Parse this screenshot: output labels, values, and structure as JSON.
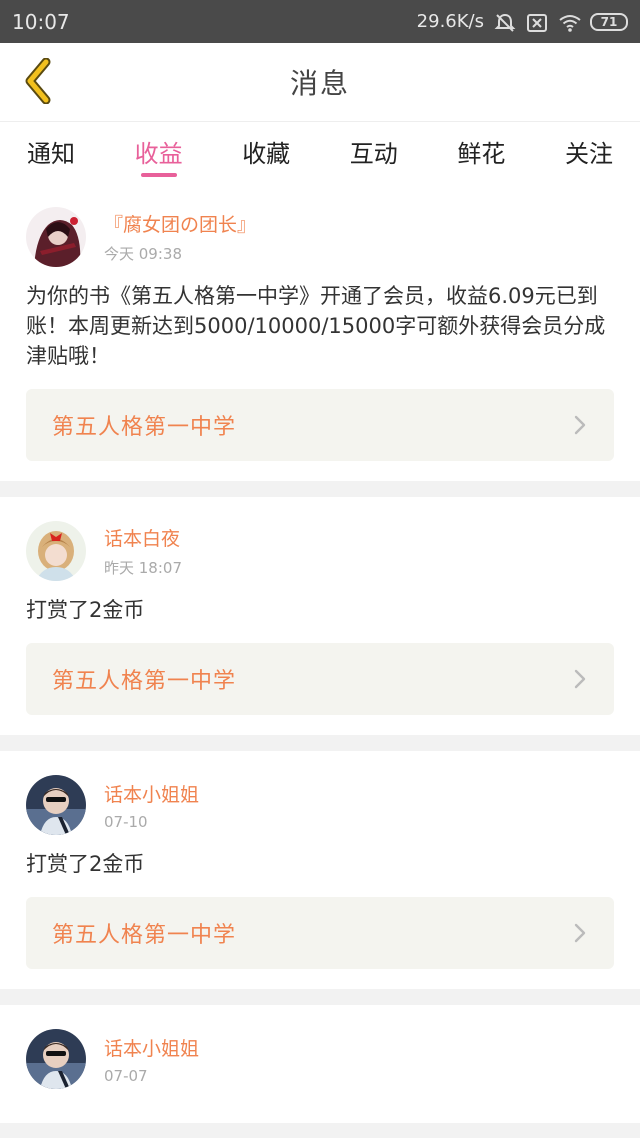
{
  "status_bar": {
    "time": "10:07",
    "speed": "29.6K/s",
    "battery": "71",
    "icons": [
      "mute-bell-icon",
      "sim-x-icon",
      "wifi-icon",
      "battery-icon"
    ]
  },
  "header": {
    "title": "消息",
    "back_icon": "chevron-left-icon"
  },
  "tabs": [
    {
      "label": "通知",
      "active": false
    },
    {
      "label": "收益",
      "active": true
    },
    {
      "label": "收藏",
      "active": false
    },
    {
      "label": "互动",
      "active": false
    },
    {
      "label": "鲜花",
      "active": false
    },
    {
      "label": "关注",
      "active": false
    }
  ],
  "messages": [
    {
      "user": "『腐女团の团长』",
      "time": "今天 09:38",
      "text": "为你的书《第五人格第一中学》开通了会员，收益6.09元已到账！本周更新达到5000/10000/15000字可额外获得会员分成津贴哦！",
      "book": "第五人格第一中学"
    },
    {
      "user": "话本白夜",
      "time": "昨天 18:07",
      "text": "打赏了2金币",
      "book": "第五人格第一中学"
    },
    {
      "user": "话本小姐姐",
      "time": "07-10",
      "text": "打赏了2金币",
      "book": "第五人格第一中学"
    },
    {
      "user": "话本小姐姐",
      "time": "07-07",
      "text": "",
      "book": ""
    }
  ],
  "colors": {
    "accent_pink": "#e8609a",
    "accent_orange": "#f0834f",
    "back_yellow": "#e8b21a"
  }
}
